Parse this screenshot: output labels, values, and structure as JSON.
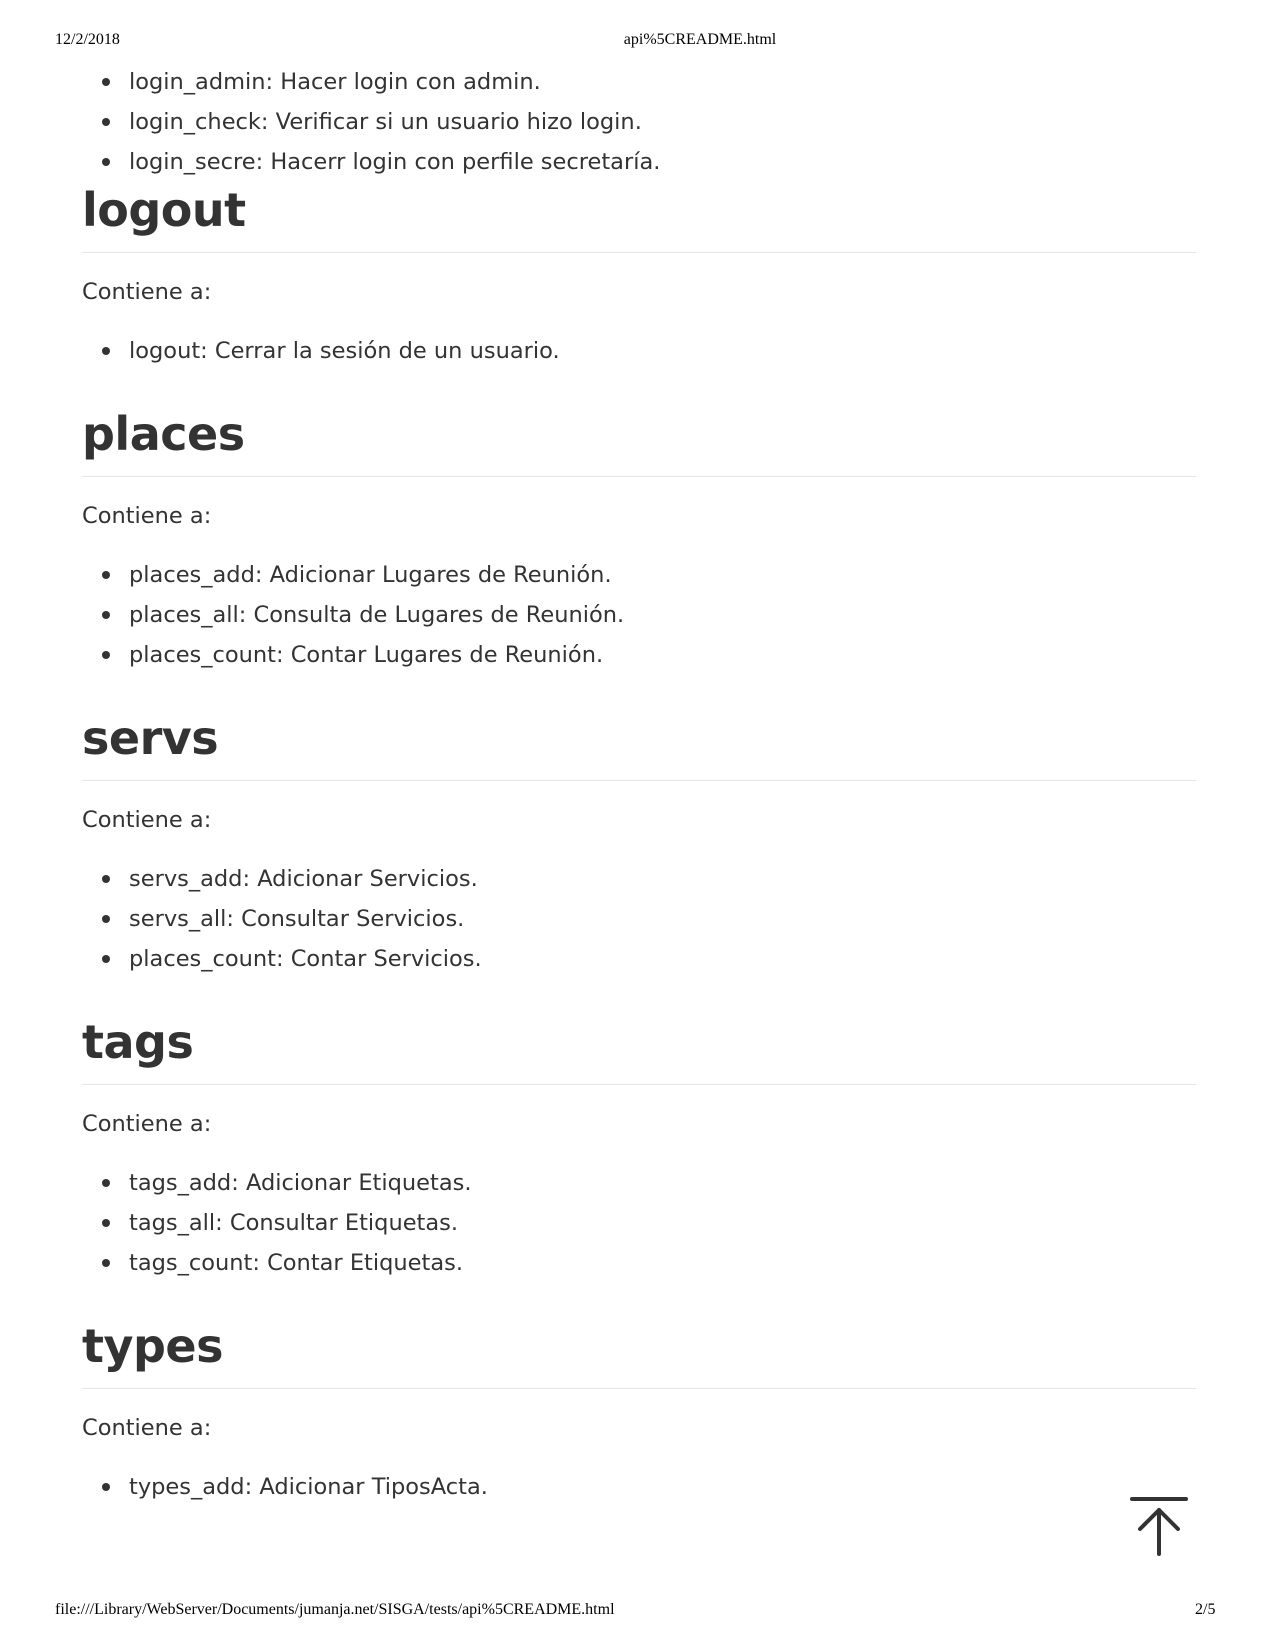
{
  "print_header": {
    "date": "12/2/2018",
    "title": "api%5CREADME.html"
  },
  "print_footer": {
    "url": "file:///Library/WebServer/Documents/jumanja.net/SISGA/tests/api%5CREADME.html",
    "page": "2/5"
  },
  "continued_list": [
    "login_admin: Hacer login con admin.",
    "login_check: Verificar si un usuario hizo login.",
    "login_secre: Hacerr login con perfile secretaría."
  ],
  "sections": [
    {
      "heading": "logout",
      "intro": "Contiene a:",
      "items": [
        "logout: Cerrar la sesión de un usuario."
      ]
    },
    {
      "heading": "places",
      "intro": "Contiene a:",
      "items": [
        "places_add: Adicionar Lugares de Reunión.",
        "places_all: Consulta de Lugares de Reunión.",
        "places_count: Contar Lugares de Reunión."
      ]
    },
    {
      "heading": "servs",
      "intro": "Contiene a:",
      "items": [
        "servs_add: Adicionar Servicios.",
        "servs_all: Consultar Servicios.",
        "places_count: Contar Servicios."
      ]
    },
    {
      "heading": "tags",
      "intro": "Contiene a:",
      "items": [
        "tags_add: Adicionar Etiquetas.",
        "tags_all: Consultar Etiquetas.",
        "tags_count: Contar Etiquetas."
      ]
    },
    {
      "heading": "types",
      "intro": "Contiene a:",
      "items": [
        "types_add: Adicionar TiposActa."
      ]
    }
  ],
  "icons": {
    "back_to_top": "arrow-up-to-line-icon"
  }
}
